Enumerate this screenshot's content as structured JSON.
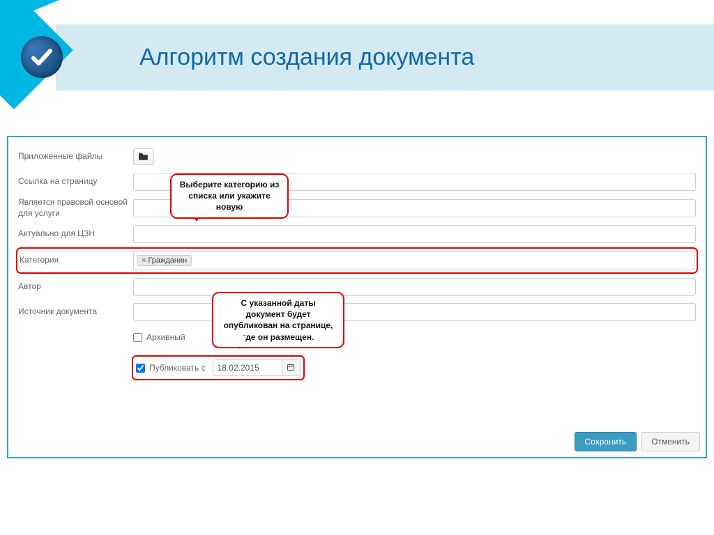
{
  "header": {
    "title": "Алгоритм создания документа"
  },
  "form": {
    "labels": {
      "attached_files": "Приложенные файлы",
      "page_link": "Ссылка на страницу",
      "legal_basis": "Является правовой основой для услуги",
      "czn": "Актуально для ЦЗН",
      "category": "Категория",
      "author": "Автор",
      "source": "Источник документа",
      "archive": "Архивный",
      "publish_from": "Публиковать с"
    },
    "category_tag": "Гражданин",
    "publish_date": "18.02.2015"
  },
  "callouts": {
    "category": "Выберите категорию из списка или укажите новую",
    "publish": "С указанной даты документ будет опубликован на странице, где он размещен."
  },
  "buttons": {
    "save": "Сохранить",
    "cancel": "Отменить"
  }
}
